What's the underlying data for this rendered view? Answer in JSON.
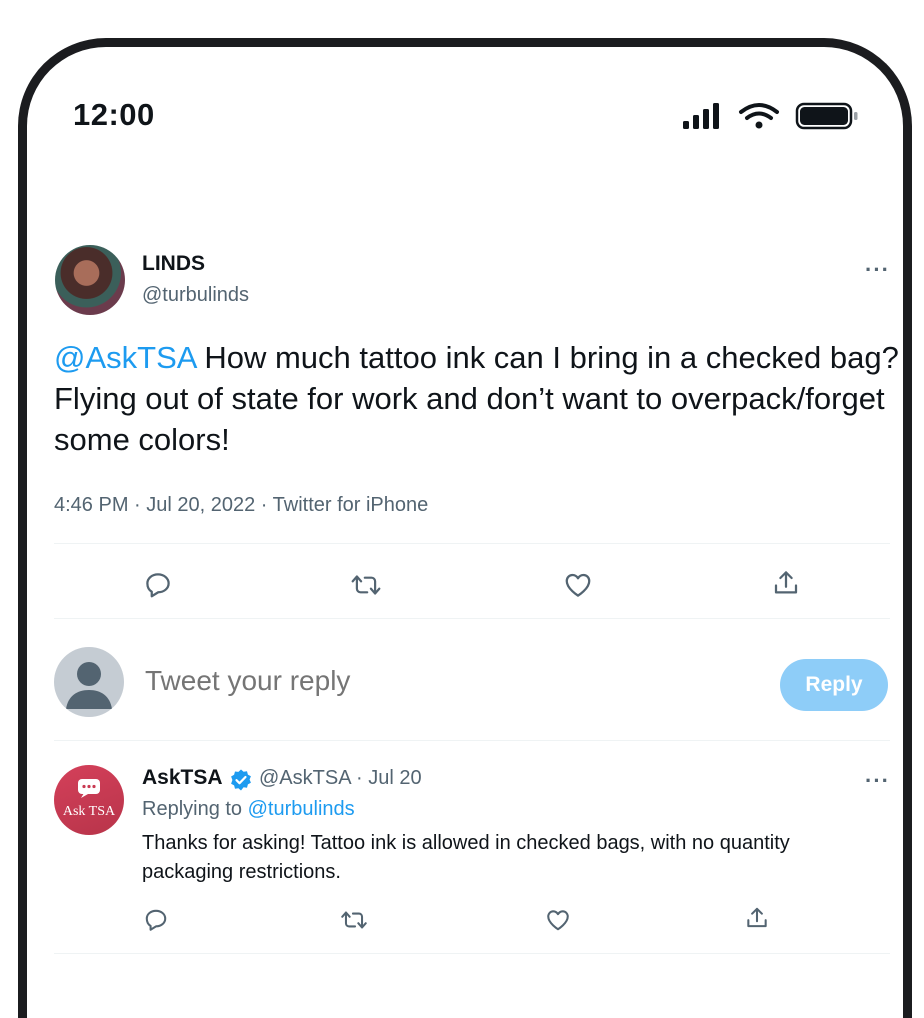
{
  "status_bar": {
    "time": "12:00",
    "icons": [
      "signal-icon",
      "wifi-icon",
      "battery-icon"
    ]
  },
  "tweet": {
    "author_name": "LINDS",
    "author_handle": "@turbulinds",
    "mention": "@AskTSA",
    "text": " How much tattoo ink can I bring in a checked bag? Flying out of state for work and don’t want to overpack/forget some colors!",
    "meta": "4:46 PM · Jul 20, 2022 · Twitter for iPhone",
    "more": "···"
  },
  "actions": [
    "reply-icon",
    "retweet-icon",
    "like-icon",
    "share-icon"
  ],
  "reply_box": {
    "placeholder": "Tweet your reply",
    "button_label": "Reply"
  },
  "reply": {
    "author_name": "AskTSA",
    "handle_date": "@AskTSA · Jul 20",
    "replying_prefix": "Replying to ",
    "replying_to": "@turbulinds",
    "text": "Thanks for asking! Tattoo ink is allowed in checked bags, with no quantity packaging restrictions.",
    "avatar_text": "Ask TSA",
    "more": "···"
  },
  "colors": {
    "accent": "#1d9bf0",
    "muted": "#536471",
    "reply_button": "#8ecdf8",
    "tsa_red": "#c93a52"
  }
}
